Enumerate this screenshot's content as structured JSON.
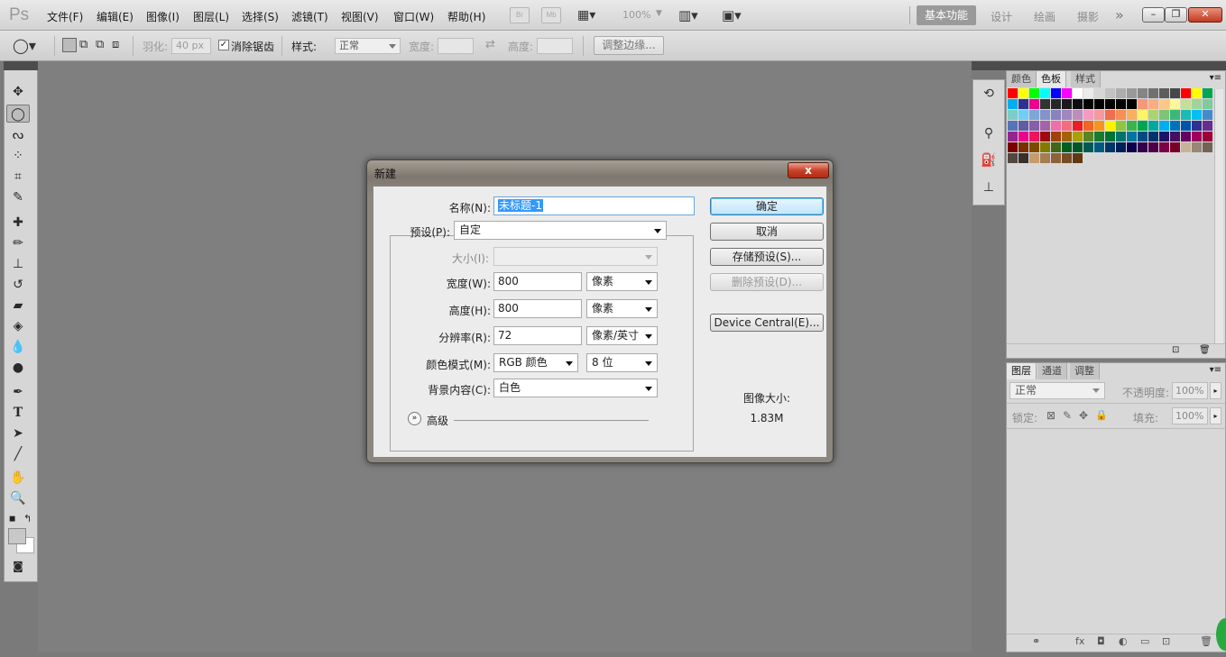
{
  "app": {
    "logo": "Ps"
  },
  "menu": [
    "文件(F)",
    "编辑(E)",
    "图像(I)",
    "图层(L)",
    "选择(S)",
    "滤镜(T)",
    "视图(V)",
    "窗口(W)",
    "帮助(H)"
  ],
  "menubar_tools": {
    "br": "Br",
    "mb": "Mb",
    "zoom": "100%"
  },
  "workspaces": {
    "active": "基本功能",
    "others": [
      "设计",
      "绘画",
      "摄影"
    ],
    "more": "»"
  },
  "window_controls": {
    "minimize": "–",
    "restore": "❐",
    "close": "✕"
  },
  "options": {
    "feather_label": "羽化:",
    "feather_value": "40 px",
    "antialias_label": "消除锯齿",
    "style_label": "样式:",
    "style_value": "正常",
    "width_label": "宽度:",
    "height_label": "高度:",
    "refine_edge": "调整边缘..."
  },
  "swatch_tabs": [
    "颜色",
    "色板",
    "样式"
  ],
  "layer_tabs": [
    "图层",
    "通道",
    "调整"
  ],
  "layers": {
    "blend_mode": "正常",
    "opacity_label": "不透明度:",
    "opacity_value": "100%",
    "lock_label": "锁定:",
    "fill_label": "填充:",
    "fill_value": "100%"
  },
  "dialog": {
    "title": "新建",
    "close": "x",
    "name_label": "名称(N):",
    "name_value": "未标题-1",
    "preset_label": "预设(P):",
    "preset_value": "自定",
    "size_label": "大小(I):",
    "width_label": "宽度(W):",
    "width_value": "800",
    "width_unit": "像素",
    "height_label": "高度(H):",
    "height_value": "800",
    "height_unit": "像素",
    "resolution_label": "分辨率(R):",
    "resolution_value": "72",
    "resolution_unit": "像素/英寸",
    "color_mode_label": "颜色模式(M):",
    "color_mode_value": "RGB 颜色",
    "bit_depth": "8 位",
    "background_label": "背景内容(C):",
    "background_value": "白色",
    "advanced": "高级",
    "ok": "确定",
    "cancel": "取消",
    "save_preset": "存储预设(S)...",
    "delete_preset": "删除预设(D)...",
    "device_central": "Device Central(E)...",
    "image_size_label": "图像大小:",
    "image_size_value": "1.83M"
  },
  "swatch_colors": [
    "#ff0000",
    "#ffff00",
    "#00ff00",
    "#00ffff",
    "#0000ff",
    "#ff00ff",
    "#ffffff",
    "#ebebeb",
    "#d6d6d6",
    "#c2c2c2",
    "#adadad",
    "#999999",
    "#858585",
    "#707070",
    "#5c5c5c",
    "#474747",
    "#ff0000",
    "#ffff00",
    "#00a651",
    "#00aeef",
    "#2e3192",
    "#ec008c",
    "#333333",
    "#262626",
    "#1a1a1a",
    "#0d0d0d",
    "#000000",
    "#000000",
    "#000000",
    "#000000",
    "#000000",
    "#f7977a",
    "#f9ad81",
    "#fdc68a",
    "#fff79a",
    "#c4df9b",
    "#a3d39c",
    "#82ca9d",
    "#7bcdc8",
    "#6ecff6",
    "#7ea7d8",
    "#8493ca",
    "#8882be",
    "#a187be",
    "#bc8dbf",
    "#f49ac2",
    "#f6989d",
    "#f26c4f",
    "#f68e55",
    "#fbaf5c",
    "#fff467",
    "#acd372",
    "#7cc576",
    "#3bb878",
    "#1abbb4",
    "#00bff3",
    "#438ccb",
    "#5574b9",
    "#605ca8",
    "#855fa8",
    "#a763a8",
    "#f06ea9",
    "#f26d7d",
    "#ed1c24",
    "#f26522",
    "#f7941d",
    "#fff200",
    "#8dc73f",
    "#39b54a",
    "#00a651",
    "#00a99d",
    "#00aeef",
    "#0072bc",
    "#0054a6",
    "#2e3192",
    "#662d91",
    "#92278f",
    "#ec008c",
    "#ed145b",
    "#9e0b0f",
    "#a0410d",
    "#a3620a",
    "#aba000",
    "#598527",
    "#197b30",
    "#007236",
    "#00746b",
    "#0076a3",
    "#004b80",
    "#003471",
    "#1b1464",
    "#440e62",
    "#630460",
    "#9e005d",
    "#9e0039",
    "#790000",
    "#7b2e00",
    "#7d4900",
    "#827b00",
    "#406618",
    "#005e20",
    "#005826",
    "#005952",
    "#005b7f",
    "#003663",
    "#002157",
    "#0d004c",
    "#32004b",
    "#4b0049",
    "#7b0046",
    "#7a0026",
    "#c7b299",
    "#998675",
    "#736357",
    "#534741",
    "#37302d",
    "#c69c6d",
    "#a67c52",
    "#8c6239",
    "#754c24",
    "#603913"
  ]
}
